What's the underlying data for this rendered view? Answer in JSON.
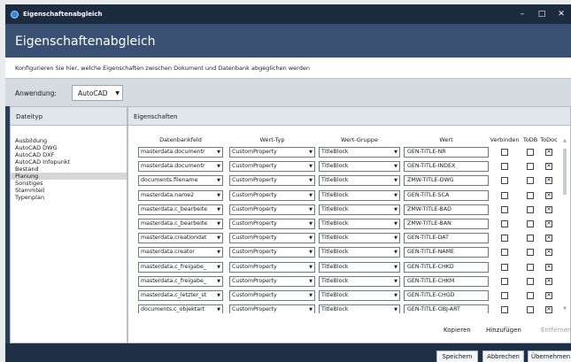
{
  "window": {
    "title": "Eigenschaftenabgleich",
    "controls": [
      "–",
      "□",
      "✕"
    ]
  },
  "header": {
    "title": "Eigenschaftenabgleich"
  },
  "description": "Konfigurieren Sie hier, welche Eigenschaften zwischen Dokument und Datenbank abgeglichen werden",
  "application": {
    "label": "Anwendung:",
    "selected": "AutoCAD"
  },
  "filetypes": {
    "header": "Dateityp",
    "items": [
      "Ausbildung",
      "AutoCAD DWG",
      "AutoCAD DXF",
      "AutoCAD Infopunkt",
      "Bestand",
      "Planung",
      "Sonstiges",
      "Stammteil",
      "Typenplan"
    ],
    "selected": "Planung"
  },
  "properties": {
    "header": "Eigenschaften",
    "columns": [
      "Datenbankfeld",
      "Wert-Typ",
      "Wert-Gruppe",
      "Wert",
      "Verbinden",
      "ToDB",
      "ToDoc"
    ],
    "rows": [
      {
        "field": "masterdata.documentr",
        "type": "CustomProperty",
        "group": "TitleBlock",
        "value": "GEN-TITLE-NR",
        "verbinden": false,
        "todb": false,
        "todoc": true
      },
      {
        "field": "masterdata.documentr",
        "type": "CustomProperty",
        "group": "TitleBlock",
        "value": "GEN-TITLE-INDEX",
        "verbinden": false,
        "todb": false,
        "todoc": true
      },
      {
        "field": "documents.filename",
        "type": "CustomProperty",
        "group": "TitleBlock",
        "value": "ZMW-TITLE-DWG",
        "verbinden": false,
        "todb": false,
        "todoc": true
      },
      {
        "field": "masterdata.name2",
        "type": "CustomProperty",
        "group": "TitleBlock",
        "value": "GEN-TITLE-SCA",
        "verbinden": false,
        "todb": false,
        "todoc": true
      },
      {
        "field": "masterdata.c_bearbeite",
        "type": "CustomProperty",
        "group": "TitleBlock",
        "value": "ZMW-TITLE-BAD",
        "verbinden": false,
        "todb": false,
        "todoc": true
      },
      {
        "field": "masterdata.c_bearbeite",
        "type": "CustomProperty",
        "group": "TitleBlock",
        "value": "ZMW-TITLE-BAN",
        "verbinden": false,
        "todb": false,
        "todoc": true
      },
      {
        "field": "masterdata.creationdat",
        "type": "CustomProperty",
        "group": "TitleBlock",
        "value": "GEN-TITLE-DAT",
        "verbinden": false,
        "todb": false,
        "todoc": true
      },
      {
        "field": "masterdata.creator",
        "type": "CustomProperty",
        "group": "TitleBlock",
        "value": "GEN-TITLE-NAME",
        "verbinden": false,
        "todb": false,
        "todoc": true
      },
      {
        "field": "masterdata.c_freigabe_",
        "type": "CustomProperty",
        "group": "TitleBlock",
        "value": "GEN-TITLE-CHKD",
        "verbinden": false,
        "todb": false,
        "todoc": true
      },
      {
        "field": "masterdata.c_freigabe_",
        "type": "CustomProperty",
        "group": "TitleBlock",
        "value": "GEN-TITLE-CHKM",
        "verbinden": false,
        "todb": false,
        "todoc": true
      },
      {
        "field": "masterdata.c_letzter_st",
        "type": "CustomProperty",
        "group": "TitleBlock",
        "value": "GEN-TITLE-CHGD",
        "verbinden": false,
        "todb": false,
        "todoc": true
      },
      {
        "field": "documents.c_objektart",
        "type": "CustomProperty",
        "group": "TitleBlock",
        "value": "GEN-TITLE-OBJ-ART",
        "verbinden": false,
        "todb": false,
        "todoc": true
      }
    ]
  },
  "actions": {
    "copy": "Kopieren",
    "add": "Hinzufügen",
    "remove": "Entfernen"
  },
  "footer": {
    "save": "Speichern",
    "cancel": "Abbrechen",
    "apply": "Übernehmen"
  }
}
